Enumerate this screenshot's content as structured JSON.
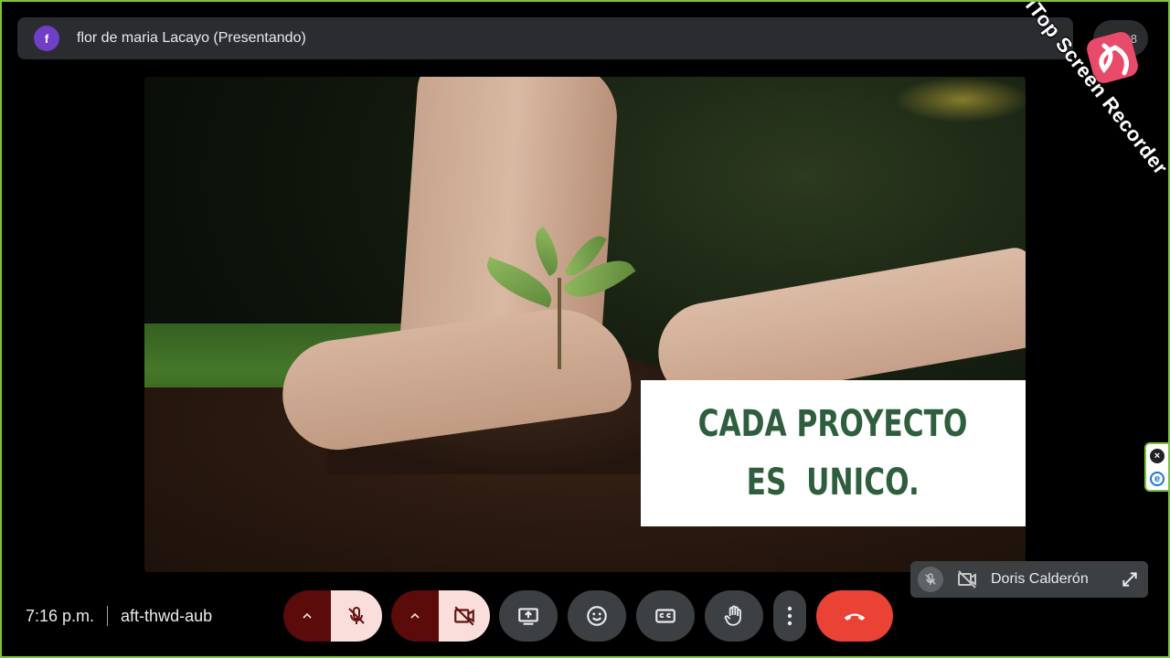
{
  "presenter": {
    "avatar_letter": "f",
    "name": "flor de maria Lacayo (Presentando)"
  },
  "people_count": "8",
  "watermark": {
    "text": "iTop Screen Recorder"
  },
  "slide": {
    "caption_line1": "CADA PROYECTO",
    "caption_line2": "ES  UNICO."
  },
  "self_tile": {
    "name": "Doris Calderón"
  },
  "meeting": {
    "time": "7:16 p.m.",
    "code": "aft-thwd-aub"
  },
  "colors": {
    "end_call": "#ea4335",
    "muted_chevron": "#5c0b0b",
    "muted_button": "#f9dedc",
    "caption_text": "#2f5e3e",
    "frame_border": "#7cc242"
  },
  "icons": [
    "mic-off-icon",
    "camera-off-icon",
    "present-screen-icon",
    "emoji-icon",
    "captions-icon",
    "raise-hand-icon",
    "more-options-icon",
    "end-call-icon",
    "expand-icon",
    "close-icon",
    "extension-icon",
    "chevron-up-icon"
  ]
}
